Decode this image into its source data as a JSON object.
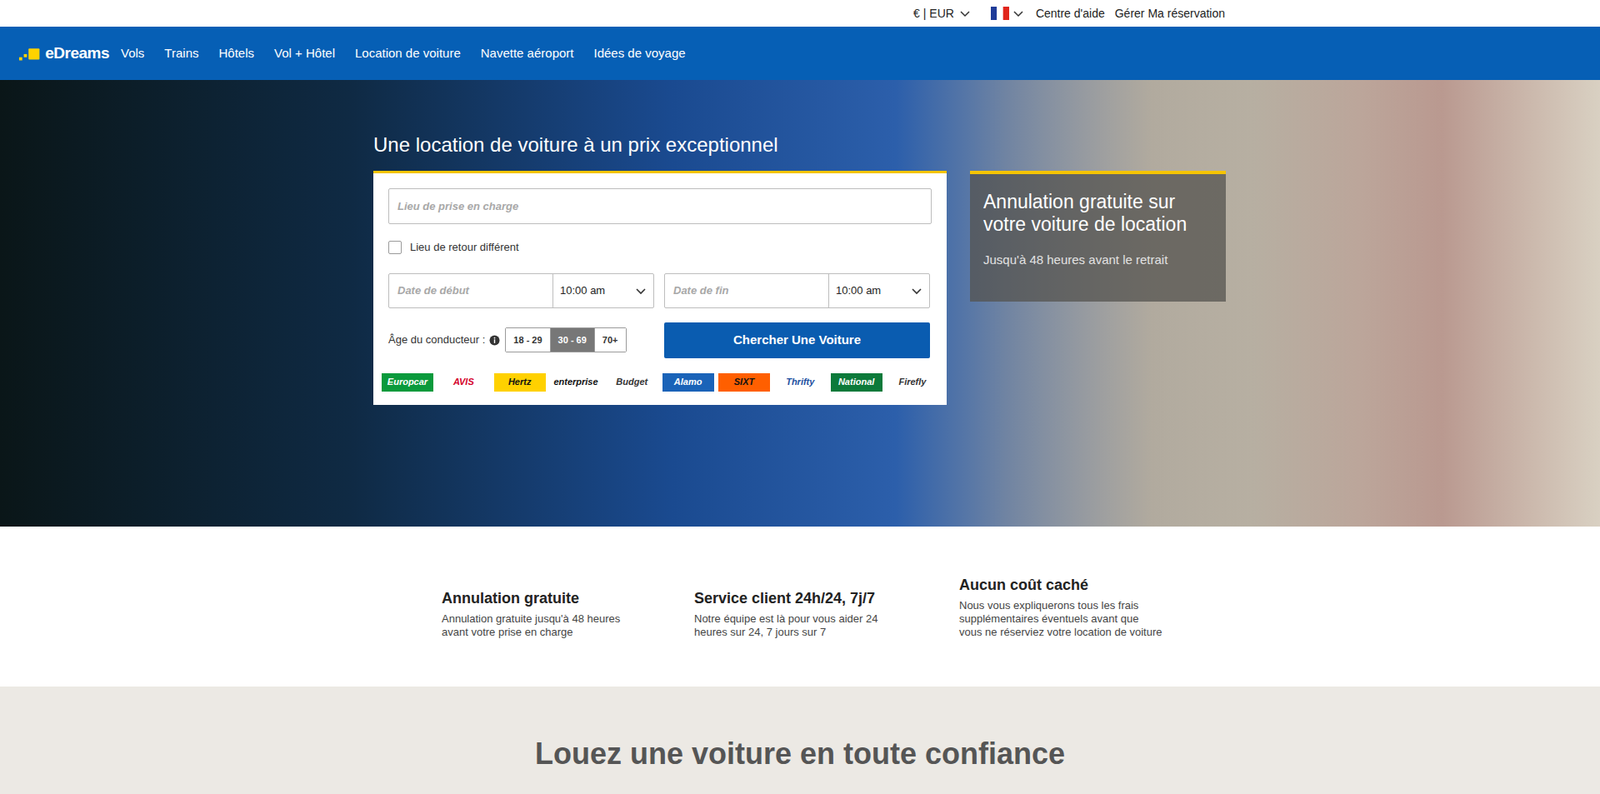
{
  "topbar": {
    "currency": "€ | EUR",
    "links": [
      "Centre d'aide",
      "Gérer Ma réservation"
    ]
  },
  "nav": {
    "logo": "eDreams",
    "items": [
      "Vols",
      "Trains",
      "Hôtels",
      "Vol + Hôtel",
      "Location de voiture",
      "Navette aéroport",
      "Idées de voyage"
    ]
  },
  "hero": {
    "heading": "Une location de voiture à un prix exceptionnel",
    "form": {
      "pickup_placeholder": "Lieu de prise en charge",
      "different_return": {
        "label": "Lieu de retour différent",
        "checked": false
      },
      "start": {
        "placeholder": "Date de début",
        "time": "10:00 am"
      },
      "end": {
        "placeholder": "Date de fin",
        "time": "10:00 am"
      },
      "age": {
        "label": "Âge du conducteur :",
        "options": [
          {
            "label": "18 - 29",
            "selected": false
          },
          {
            "label": "30 - 69",
            "selected": true
          },
          {
            "label": "70+",
            "selected": false
          }
        ]
      },
      "search_button": "Chercher Une Voiture",
      "brands": [
        {
          "label": "Europcar",
          "color": "#ffffff",
          "bg": "#0a9a3c"
        },
        {
          "label": "AVIS",
          "color": "#d4002a",
          "bg": "#ffffff"
        },
        {
          "label": "Hertz",
          "color": "#111111",
          "bg": "#ffd100"
        },
        {
          "label": "enterprise",
          "color": "#111111",
          "bg": "#ffffff"
        },
        {
          "label": "Budget",
          "color": "#333333",
          "bg": "#ffffff"
        },
        {
          "label": "Alamo",
          "color": "#ffffff",
          "bg": "#1a63b8"
        },
        {
          "label": "SIXT",
          "color": "#111111",
          "bg": "#ff5f00"
        },
        {
          "label": "Thrifty",
          "color": "#1c4fa0",
          "bg": "#ffffff"
        },
        {
          "label": "National",
          "color": "#ffffff",
          "bg": "#0c7a3a"
        },
        {
          "label": "Firefly",
          "color": "#333333",
          "bg": "#ffffff"
        }
      ]
    },
    "promo": {
      "title": "Annulation gratuite sur votre voiture de location",
      "subtitle": "Jusqu'à 48 heures avant le retrait"
    }
  },
  "features": [
    {
      "title": "Annulation gratuite",
      "text": "Annulation gratuite jusqu'à 48 heures avant votre prise en charge"
    },
    {
      "title": "Service client 24h/24, 7j/7",
      "text": "Notre équipe est là pour vous aider 24 heures sur 24, 7 jours sur 7"
    },
    {
      "title": "Aucun coût caché",
      "text": "Nous vous expliquerons tous les frais supplémentaires éventuels avant que vous ne réserviez votre location de voiture"
    }
  ],
  "trust_heading": "Louez une voiture en toute confiance"
}
